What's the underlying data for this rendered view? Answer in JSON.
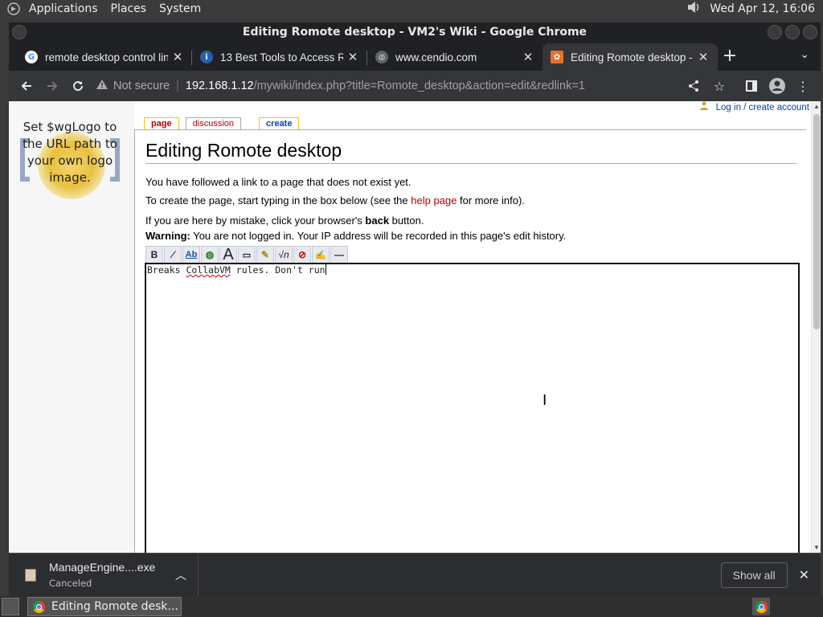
{
  "desktop": {
    "menus": [
      "Applications",
      "Places",
      "System"
    ],
    "clock": "Wed Apr 12, 16:06"
  },
  "window": {
    "title": "Editing Romote desktop - VM2's Wiki - Google Chrome"
  },
  "tabs": [
    {
      "label": "remote desktop control linu",
      "favicon": "google-icon"
    },
    {
      "label": "13 Best Tools to Access R",
      "favicon": "info-icon"
    },
    {
      "label": "www.cendio.com",
      "favicon": "globe-icon"
    },
    {
      "label": "Editing Romote desktop - V",
      "favicon": "wiki-icon",
      "active": true
    }
  ],
  "toolbar": {
    "security_label": "Not secure",
    "url_host": "192.168.1.12",
    "url_path": "/mywiki/index.php?title=Romote_desktop&action=edit&redlink=1"
  },
  "wiki": {
    "logo_text": "Set $wgLogo to the URL path to your own logo image.",
    "personal_link": "Log in / create account",
    "page_tabs": {
      "page": "page",
      "discussion": "discussion",
      "create": "create"
    },
    "heading": "Editing Romote desktop",
    "line1": "You have followed a link to a page that does not exist yet.",
    "line2_before": "To create the page, start typing in the box below (see the ",
    "line2_link": "help page",
    "line2_after": " for more info).",
    "line3_before": "If you are here by mistake, click your browser's ",
    "line3_bold": "back",
    "line3_after": " button.",
    "warning_label": "Warning:",
    "warning_text": " You are not logged in. Your IP address will be recorded in this page's edit history.",
    "editor_word1": "Breaks ",
    "editor_word2": "CollabVM",
    "editor_rest": " rules. Don't run"
  },
  "downloads": {
    "filename": "ManageEngine....exe",
    "status": "Canceled",
    "show_all": "Show all"
  },
  "taskbar": {
    "window_label": "Editing Romote desk..."
  }
}
